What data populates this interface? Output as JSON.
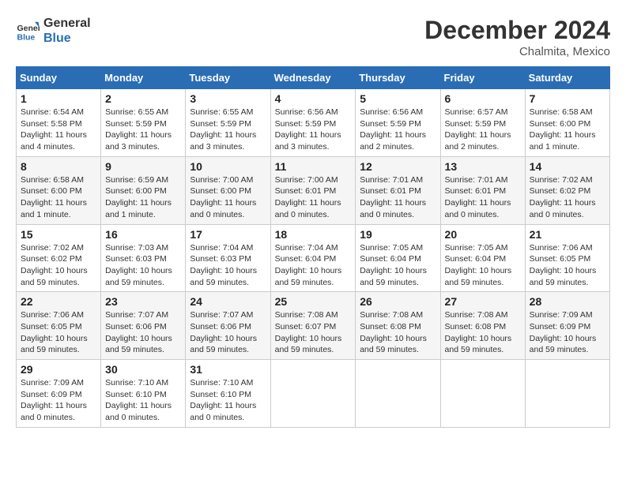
{
  "header": {
    "logo_line1": "General",
    "logo_line2": "Blue",
    "month": "December 2024",
    "location": "Chalmita, Mexico"
  },
  "weekdays": [
    "Sunday",
    "Monday",
    "Tuesday",
    "Wednesday",
    "Thursday",
    "Friday",
    "Saturday"
  ],
  "weeks": [
    [
      {
        "day": "1",
        "sunrise": "6:54 AM",
        "sunset": "5:58 PM",
        "daylight": "11 hours and 4 minutes."
      },
      {
        "day": "2",
        "sunrise": "6:55 AM",
        "sunset": "5:59 PM",
        "daylight": "11 hours and 3 minutes."
      },
      {
        "day": "3",
        "sunrise": "6:55 AM",
        "sunset": "5:59 PM",
        "daylight": "11 hours and 3 minutes."
      },
      {
        "day": "4",
        "sunrise": "6:56 AM",
        "sunset": "5:59 PM",
        "daylight": "11 hours and 3 minutes."
      },
      {
        "day": "5",
        "sunrise": "6:56 AM",
        "sunset": "5:59 PM",
        "daylight": "11 hours and 2 minutes."
      },
      {
        "day": "6",
        "sunrise": "6:57 AM",
        "sunset": "5:59 PM",
        "daylight": "11 hours and 2 minutes."
      },
      {
        "day": "7",
        "sunrise": "6:58 AM",
        "sunset": "6:00 PM",
        "daylight": "11 hours and 1 minute."
      }
    ],
    [
      {
        "day": "8",
        "sunrise": "6:58 AM",
        "sunset": "6:00 PM",
        "daylight": "11 hours and 1 minute."
      },
      {
        "day": "9",
        "sunrise": "6:59 AM",
        "sunset": "6:00 PM",
        "daylight": "11 hours and 1 minute."
      },
      {
        "day": "10",
        "sunrise": "7:00 AM",
        "sunset": "6:00 PM",
        "daylight": "11 hours and 0 minutes."
      },
      {
        "day": "11",
        "sunrise": "7:00 AM",
        "sunset": "6:01 PM",
        "daylight": "11 hours and 0 minutes."
      },
      {
        "day": "12",
        "sunrise": "7:01 AM",
        "sunset": "6:01 PM",
        "daylight": "11 hours and 0 minutes."
      },
      {
        "day": "13",
        "sunrise": "7:01 AM",
        "sunset": "6:01 PM",
        "daylight": "11 hours and 0 minutes."
      },
      {
        "day": "14",
        "sunrise": "7:02 AM",
        "sunset": "6:02 PM",
        "daylight": "11 hours and 0 minutes."
      }
    ],
    [
      {
        "day": "15",
        "sunrise": "7:02 AM",
        "sunset": "6:02 PM",
        "daylight": "10 hours and 59 minutes."
      },
      {
        "day": "16",
        "sunrise": "7:03 AM",
        "sunset": "6:03 PM",
        "daylight": "10 hours and 59 minutes."
      },
      {
        "day": "17",
        "sunrise": "7:04 AM",
        "sunset": "6:03 PM",
        "daylight": "10 hours and 59 minutes."
      },
      {
        "day": "18",
        "sunrise": "7:04 AM",
        "sunset": "6:04 PM",
        "daylight": "10 hours and 59 minutes."
      },
      {
        "day": "19",
        "sunrise": "7:05 AM",
        "sunset": "6:04 PM",
        "daylight": "10 hours and 59 minutes."
      },
      {
        "day": "20",
        "sunrise": "7:05 AM",
        "sunset": "6:04 PM",
        "daylight": "10 hours and 59 minutes."
      },
      {
        "day": "21",
        "sunrise": "7:06 AM",
        "sunset": "6:05 PM",
        "daylight": "10 hours and 59 minutes."
      }
    ],
    [
      {
        "day": "22",
        "sunrise": "7:06 AM",
        "sunset": "6:05 PM",
        "daylight": "10 hours and 59 minutes."
      },
      {
        "day": "23",
        "sunrise": "7:07 AM",
        "sunset": "6:06 PM",
        "daylight": "10 hours and 59 minutes."
      },
      {
        "day": "24",
        "sunrise": "7:07 AM",
        "sunset": "6:06 PM",
        "daylight": "10 hours and 59 minutes."
      },
      {
        "day": "25",
        "sunrise": "7:08 AM",
        "sunset": "6:07 PM",
        "daylight": "10 hours and 59 minutes."
      },
      {
        "day": "26",
        "sunrise": "7:08 AM",
        "sunset": "6:08 PM",
        "daylight": "10 hours and 59 minutes."
      },
      {
        "day": "27",
        "sunrise": "7:08 AM",
        "sunset": "6:08 PM",
        "daylight": "10 hours and 59 minutes."
      },
      {
        "day": "28",
        "sunrise": "7:09 AM",
        "sunset": "6:09 PM",
        "daylight": "10 hours and 59 minutes."
      }
    ],
    [
      {
        "day": "29",
        "sunrise": "7:09 AM",
        "sunset": "6:09 PM",
        "daylight": "11 hours and 0 minutes."
      },
      {
        "day": "30",
        "sunrise": "7:10 AM",
        "sunset": "6:10 PM",
        "daylight": "11 hours and 0 minutes."
      },
      {
        "day": "31",
        "sunrise": "7:10 AM",
        "sunset": "6:10 PM",
        "daylight": "11 hours and 0 minutes."
      },
      null,
      null,
      null,
      null
    ]
  ]
}
